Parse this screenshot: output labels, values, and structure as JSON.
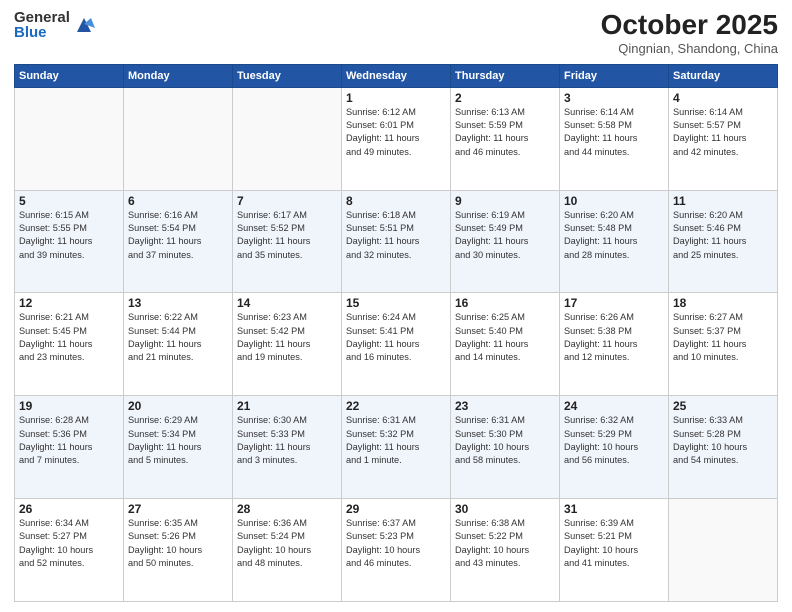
{
  "header": {
    "logo_general": "General",
    "logo_blue": "Blue",
    "month": "October 2025",
    "location": "Qingnian, Shandong, China"
  },
  "days_of_week": [
    "Sunday",
    "Monday",
    "Tuesday",
    "Wednesday",
    "Thursday",
    "Friday",
    "Saturday"
  ],
  "weeks": [
    [
      {
        "day": "",
        "info": ""
      },
      {
        "day": "",
        "info": ""
      },
      {
        "day": "",
        "info": ""
      },
      {
        "day": "1",
        "info": "Sunrise: 6:12 AM\nSunset: 6:01 PM\nDaylight: 11 hours\nand 49 minutes."
      },
      {
        "day": "2",
        "info": "Sunrise: 6:13 AM\nSunset: 5:59 PM\nDaylight: 11 hours\nand 46 minutes."
      },
      {
        "day": "3",
        "info": "Sunrise: 6:14 AM\nSunset: 5:58 PM\nDaylight: 11 hours\nand 44 minutes."
      },
      {
        "day": "4",
        "info": "Sunrise: 6:14 AM\nSunset: 5:57 PM\nDaylight: 11 hours\nand 42 minutes."
      }
    ],
    [
      {
        "day": "5",
        "info": "Sunrise: 6:15 AM\nSunset: 5:55 PM\nDaylight: 11 hours\nand 39 minutes."
      },
      {
        "day": "6",
        "info": "Sunrise: 6:16 AM\nSunset: 5:54 PM\nDaylight: 11 hours\nand 37 minutes."
      },
      {
        "day": "7",
        "info": "Sunrise: 6:17 AM\nSunset: 5:52 PM\nDaylight: 11 hours\nand 35 minutes."
      },
      {
        "day": "8",
        "info": "Sunrise: 6:18 AM\nSunset: 5:51 PM\nDaylight: 11 hours\nand 32 minutes."
      },
      {
        "day": "9",
        "info": "Sunrise: 6:19 AM\nSunset: 5:49 PM\nDaylight: 11 hours\nand 30 minutes."
      },
      {
        "day": "10",
        "info": "Sunrise: 6:20 AM\nSunset: 5:48 PM\nDaylight: 11 hours\nand 28 minutes."
      },
      {
        "day": "11",
        "info": "Sunrise: 6:20 AM\nSunset: 5:46 PM\nDaylight: 11 hours\nand 25 minutes."
      }
    ],
    [
      {
        "day": "12",
        "info": "Sunrise: 6:21 AM\nSunset: 5:45 PM\nDaylight: 11 hours\nand 23 minutes."
      },
      {
        "day": "13",
        "info": "Sunrise: 6:22 AM\nSunset: 5:44 PM\nDaylight: 11 hours\nand 21 minutes."
      },
      {
        "day": "14",
        "info": "Sunrise: 6:23 AM\nSunset: 5:42 PM\nDaylight: 11 hours\nand 19 minutes."
      },
      {
        "day": "15",
        "info": "Sunrise: 6:24 AM\nSunset: 5:41 PM\nDaylight: 11 hours\nand 16 minutes."
      },
      {
        "day": "16",
        "info": "Sunrise: 6:25 AM\nSunset: 5:40 PM\nDaylight: 11 hours\nand 14 minutes."
      },
      {
        "day": "17",
        "info": "Sunrise: 6:26 AM\nSunset: 5:38 PM\nDaylight: 11 hours\nand 12 minutes."
      },
      {
        "day": "18",
        "info": "Sunrise: 6:27 AM\nSunset: 5:37 PM\nDaylight: 11 hours\nand 10 minutes."
      }
    ],
    [
      {
        "day": "19",
        "info": "Sunrise: 6:28 AM\nSunset: 5:36 PM\nDaylight: 11 hours\nand 7 minutes."
      },
      {
        "day": "20",
        "info": "Sunrise: 6:29 AM\nSunset: 5:34 PM\nDaylight: 11 hours\nand 5 minutes."
      },
      {
        "day": "21",
        "info": "Sunrise: 6:30 AM\nSunset: 5:33 PM\nDaylight: 11 hours\nand 3 minutes."
      },
      {
        "day": "22",
        "info": "Sunrise: 6:31 AM\nSunset: 5:32 PM\nDaylight: 11 hours\nand 1 minute."
      },
      {
        "day": "23",
        "info": "Sunrise: 6:31 AM\nSunset: 5:30 PM\nDaylight: 10 hours\nand 58 minutes."
      },
      {
        "day": "24",
        "info": "Sunrise: 6:32 AM\nSunset: 5:29 PM\nDaylight: 10 hours\nand 56 minutes."
      },
      {
        "day": "25",
        "info": "Sunrise: 6:33 AM\nSunset: 5:28 PM\nDaylight: 10 hours\nand 54 minutes."
      }
    ],
    [
      {
        "day": "26",
        "info": "Sunrise: 6:34 AM\nSunset: 5:27 PM\nDaylight: 10 hours\nand 52 minutes."
      },
      {
        "day": "27",
        "info": "Sunrise: 6:35 AM\nSunset: 5:26 PM\nDaylight: 10 hours\nand 50 minutes."
      },
      {
        "day": "28",
        "info": "Sunrise: 6:36 AM\nSunset: 5:24 PM\nDaylight: 10 hours\nand 48 minutes."
      },
      {
        "day": "29",
        "info": "Sunrise: 6:37 AM\nSunset: 5:23 PM\nDaylight: 10 hours\nand 46 minutes."
      },
      {
        "day": "30",
        "info": "Sunrise: 6:38 AM\nSunset: 5:22 PM\nDaylight: 10 hours\nand 43 minutes."
      },
      {
        "day": "31",
        "info": "Sunrise: 6:39 AM\nSunset: 5:21 PM\nDaylight: 10 hours\nand 41 minutes."
      },
      {
        "day": "",
        "info": ""
      }
    ]
  ]
}
